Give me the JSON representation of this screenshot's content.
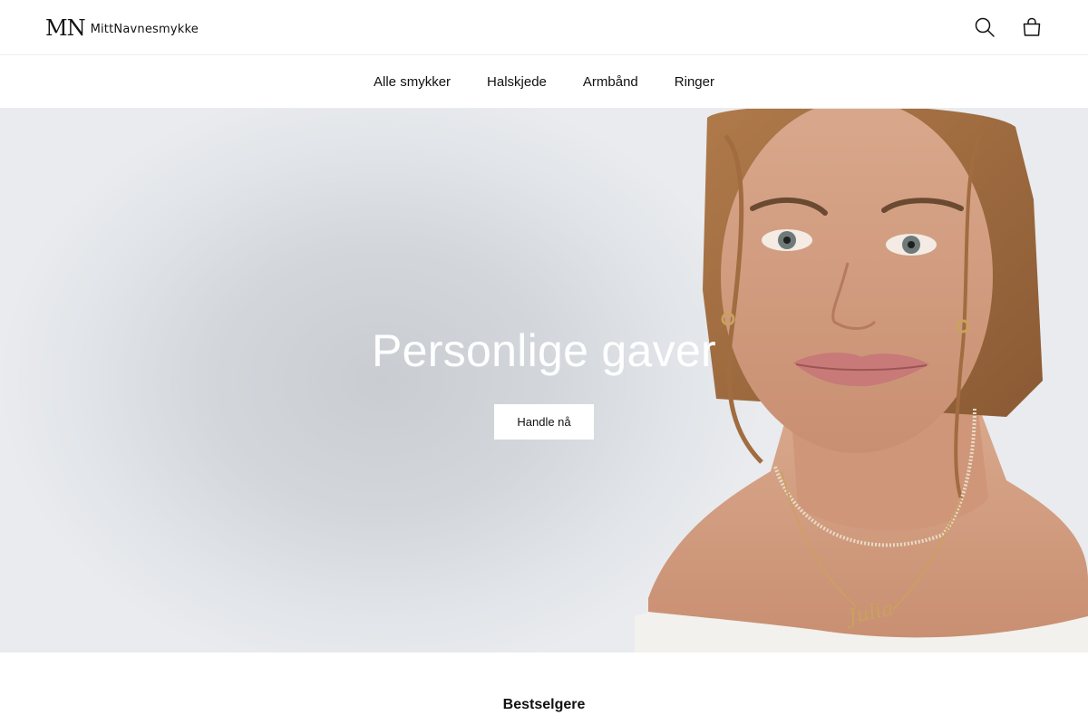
{
  "header": {
    "logo_mark": "MN",
    "logo_text": "MittNavnesmykke",
    "icons": {
      "search": "search-icon",
      "cart": "shopping-bag-icon"
    }
  },
  "nav": {
    "items": [
      {
        "label": "Alle smykker"
      },
      {
        "label": "Halskjede"
      },
      {
        "label": "Armbånd"
      },
      {
        "label": "Ringer"
      }
    ]
  },
  "hero": {
    "title": "Personlige gaver",
    "button_label": "Handle nå",
    "necklace_text": "Julia"
  },
  "bestsellers": {
    "title": "Bestselgere"
  },
  "colors": {
    "text": "#111111",
    "hero_bg": "#d3d7dc",
    "button_bg": "#ffffff",
    "gold": "#c9a25c"
  }
}
